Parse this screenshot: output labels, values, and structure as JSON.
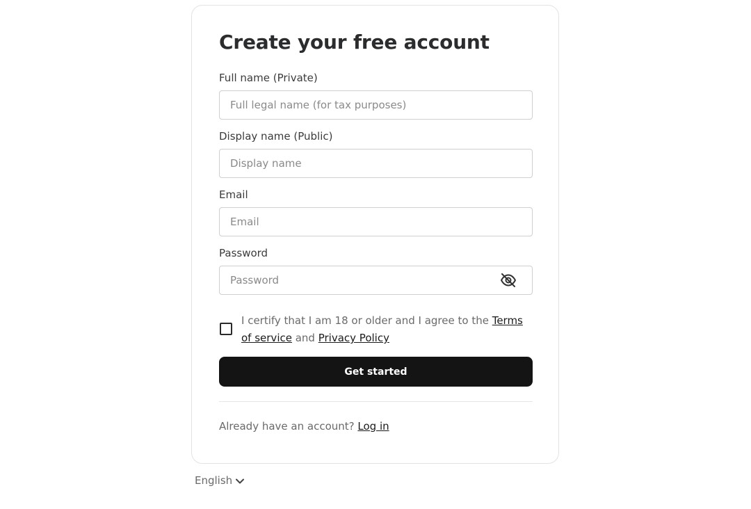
{
  "form": {
    "title": "Create your free account",
    "full_name": {
      "label": "Full name (Private)",
      "placeholder": "Full legal name (for tax purposes)",
      "value": ""
    },
    "display_name": {
      "label": "Display name (Public)",
      "placeholder": "Display name",
      "value": ""
    },
    "email": {
      "label": "Email",
      "placeholder": "Email",
      "value": ""
    },
    "password": {
      "label": "Password",
      "placeholder": "Password",
      "value": "",
      "visibility_icon": "eye-slash-icon"
    },
    "consent": {
      "checked": false,
      "prefix": "I certify that I am 18 or older and I agree to the ",
      "terms_link": "Terms of service",
      "middle": " and ",
      "privacy_link": "Privacy Policy"
    },
    "submit_label": "Get started",
    "login_prompt": "Already have an account? ",
    "login_link": "Log in"
  },
  "language": {
    "selected": "English",
    "icon": "chevron-down-icon"
  },
  "colors": {
    "button_bg": "#141414",
    "button_text": "#ffffff",
    "border": "#cfcfcf"
  }
}
